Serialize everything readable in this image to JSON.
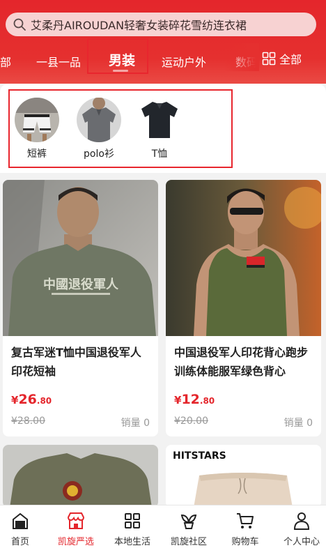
{
  "search": {
    "text": "艾柔丹AIROUDAN轻奢女装碎花雪纺连衣裙"
  },
  "categories": {
    "items": [
      "部",
      "一县一品",
      "男装",
      "运动户外",
      "数码"
    ],
    "all_label": "全部"
  },
  "subcategories": [
    "短裤",
    "polo衫",
    "T恤"
  ],
  "products": [
    {
      "title": "复古军迷T恤中国退役军人印花短袖",
      "currency": "¥",
      "price_int": "26",
      "price_dec": ".80",
      "original": "¥28.00",
      "sales": "销量 0",
      "shirt_print": "中國退役軍人"
    },
    {
      "title": "中国退役军人印花背心跑步训练体能服军绿色背心",
      "currency": "¥",
      "price_int": "12",
      "price_dec": ".80",
      "original": "¥20.00",
      "sales": "销量 0"
    },
    {
      "title": "",
      "brand": ""
    },
    {
      "title": "",
      "brand": "HITSTARS"
    }
  ],
  "tabbar": [
    {
      "label": "首页",
      "icon": "home-icon"
    },
    {
      "label": "凯旋严选",
      "icon": "store-icon",
      "active": true
    },
    {
      "label": "本地生活",
      "icon": "grid-icon"
    },
    {
      "label": "凯旋社区",
      "icon": "plant-icon"
    },
    {
      "label": "购物车",
      "icon": "cart-icon"
    },
    {
      "label": "个人中心",
      "icon": "person-icon"
    }
  ],
  "colors": {
    "accent": "#e4262c",
    "header": "#e5302f",
    "search_bg": "#f7d2d2"
  }
}
